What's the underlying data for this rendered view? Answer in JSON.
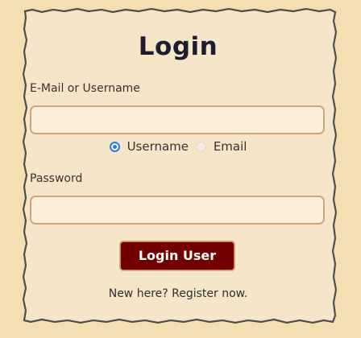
{
  "form": {
    "title": "Login",
    "identifier_label": "E-Mail or Username",
    "identifier_value": "",
    "identifier_placeholder": "",
    "radio_options": [
      {
        "label": "Username",
        "selected": true
      },
      {
        "label": "Email",
        "selected": false
      }
    ],
    "password_label": "Password",
    "password_value": "",
    "password_placeholder": "",
    "submit_label": "Login User",
    "register_text": "New here? Register now."
  },
  "colors": {
    "page_background": "#f4dfb3",
    "card_background": "#f6e6c9",
    "card_border": "#4a4a4a",
    "field_background": "#fbefd9",
    "field_border": "#d0a47a",
    "button_background": "#730000",
    "radio_selected": "#2e7be0"
  }
}
